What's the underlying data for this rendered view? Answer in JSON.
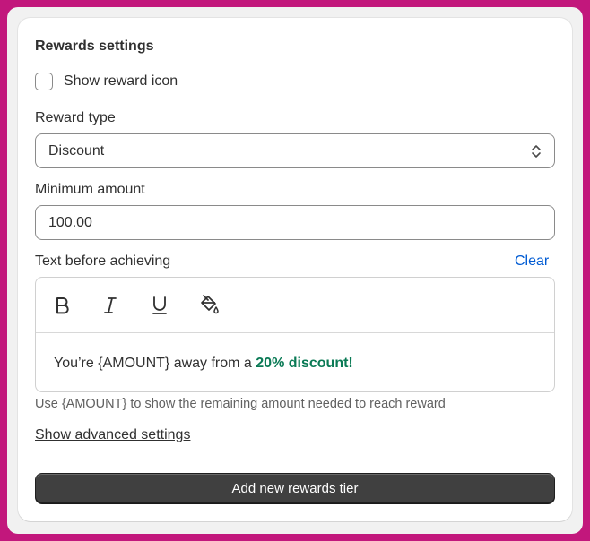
{
  "card": {
    "title": "Rewards settings",
    "show_icon_label": "Show reward icon",
    "show_icon_checked": false,
    "reward_type": {
      "label": "Reward type",
      "selected": "Discount"
    },
    "minimum_amount": {
      "label": "Minimum amount",
      "value": "100.00"
    },
    "text_before": {
      "label": "Text before achieving",
      "clear_label": "Clear",
      "toolbar": [
        "bold-icon",
        "italic-icon",
        "underline-icon",
        "paint-bucket-icon"
      ],
      "content_prefix": "You’re {AMOUNT} away from a ",
      "content_highlight": "20% discount!",
      "highlight_color": "#0a7a55"
    },
    "help_text": "Use {AMOUNT} to show the remaining amount needed to reach reward",
    "advanced_link": "Show advanced settings",
    "add_button": "Add new rewards tier"
  },
  "colors": {
    "background": "#c2177c",
    "link": "#005bd3",
    "button": "#404040"
  }
}
